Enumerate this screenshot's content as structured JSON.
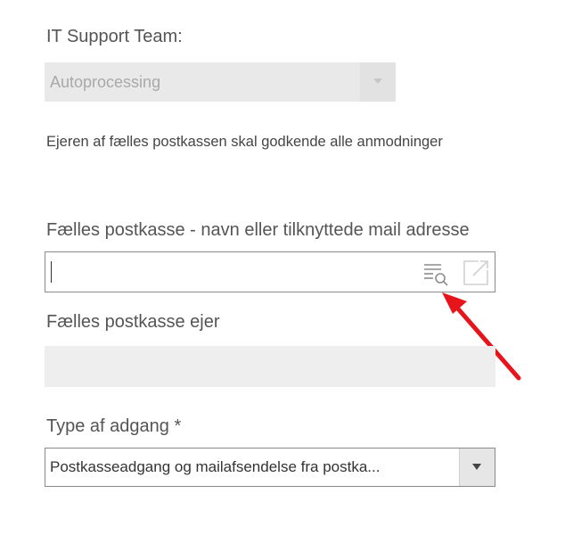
{
  "support_team": {
    "label": "IT Support Team:",
    "value": "Autoprocessing"
  },
  "note": "Ejeren af fælles postkassen skal godkende alle anmodninger",
  "shared_mailbox": {
    "label": "Fælles postkasse - navn eller tilknyttede mail adresse",
    "value": ""
  },
  "mailbox_owner": {
    "label": "Fælles postkasse ejer",
    "value": ""
  },
  "access_type": {
    "label": "Type af adgang *",
    "value": "Postkasseadgang og mailafsendelse fra postka..."
  },
  "icons": {
    "lookup": "lookup-search-icon",
    "open": "open-external-icon",
    "annotation": "red-annotation-arrow"
  },
  "colors": {
    "annotation_arrow": "#e8141c",
    "disabled_field": "#e9e9e9",
    "border": "#8a8a8a"
  }
}
